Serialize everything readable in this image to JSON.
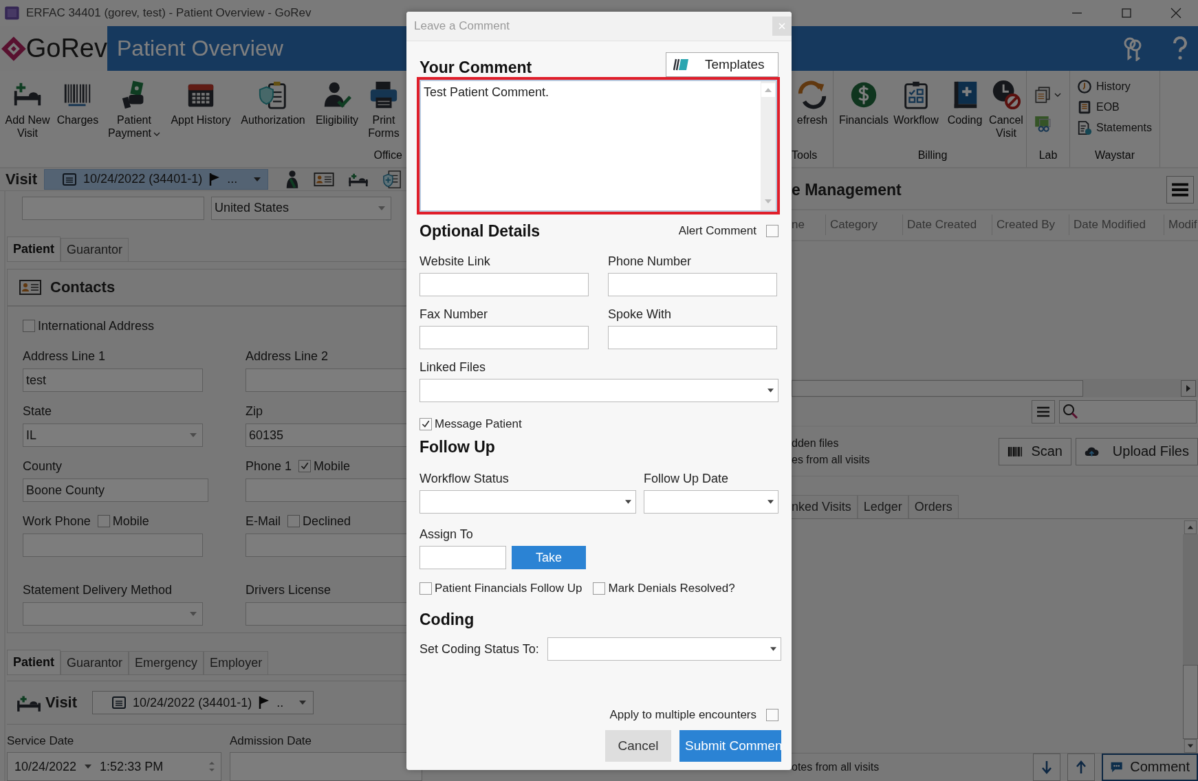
{
  "window": {
    "title": "ERFAC 34401 (gorev, test) - Patient Overview - GoRev"
  },
  "header": {
    "logo": "GoRev",
    "title": "Patient Overview"
  },
  "ribbon_left": {
    "group": "Office",
    "items": [
      {
        "label": "Add New Visit",
        "dropdown": false
      },
      {
        "label": "Charges",
        "dropdown": false
      },
      {
        "label": "Patient Payment",
        "dropdown": true
      },
      {
        "label": "Appt History",
        "dropdown": false
      },
      {
        "label": "Authorization",
        "dropdown": false
      },
      {
        "label": "Eligibility",
        "dropdown": false
      },
      {
        "label": "Print Forms",
        "dropdown": false
      }
    ]
  },
  "ribbon_right": {
    "groups": [
      {
        "label": "Tools",
        "kind": "buttons",
        "items": [
          {
            "label": "efresh"
          }
        ]
      },
      {
        "label": "Billing",
        "kind": "buttons",
        "items": [
          {
            "label": "Financials"
          },
          {
            "label": "Workflow"
          },
          {
            "label": "Coding"
          },
          {
            "label": "Cancel Visit"
          }
        ]
      },
      {
        "label": "Lab",
        "kind": "icons"
      },
      {
        "label": "Waystar",
        "kind": "list",
        "items": [
          {
            "label": "History"
          },
          {
            "label": "EOB"
          },
          {
            "label": "Statements"
          }
        ]
      }
    ]
  },
  "visit_bar": {
    "label": "Visit",
    "date": "10/24/2022 (34401-1)",
    "more": "..."
  },
  "left_panel": {
    "country": "United States",
    "tabs_top": [
      {
        "label": "Patient",
        "selected": true
      },
      {
        "label": "Guarantor",
        "selected": false
      }
    ],
    "contacts": {
      "title": "Contacts",
      "international": {
        "label": "International Address",
        "checked": false
      },
      "fields": [
        {
          "label": "Address Line 1",
          "value": "test",
          "kind": "text"
        },
        {
          "label": "Address Line 2",
          "kind": "text"
        },
        {
          "label": "State",
          "value": "IL",
          "kind": "dropdown"
        },
        {
          "label": "Zip",
          "value": "60135",
          "kind": "text"
        },
        {
          "label": "County",
          "value": "Boone County",
          "kind": "text"
        },
        {
          "label": "Phone 1",
          "kind": "text",
          "option": {
            "label": "Mobile",
            "checked": true
          }
        },
        {
          "label": "Work Phone",
          "kind": "text",
          "option": {
            "label": "Mobile",
            "checked": false
          }
        },
        {
          "label": "E-Mail",
          "kind": "text",
          "option": {
            "label": "Declined",
            "checked": false
          }
        },
        {
          "label": "Statement Delivery Method",
          "kind": "dropdown"
        },
        {
          "label": "Drivers License",
          "kind": "text"
        }
      ]
    },
    "tabs_bottom": [
      {
        "label": "Patient",
        "selected": true
      },
      {
        "label": "Guarantor",
        "selected": false
      },
      {
        "label": "Emergency",
        "selected": false
      },
      {
        "label": "Employer",
        "selected": false
      }
    ],
    "visit": {
      "label": "Visit",
      "date": "10/24/2022 (34401-1)",
      "more": ".."
    },
    "service_date": {
      "label": "Service Date",
      "date": "10/24/2022",
      "time": "1:52:33 PM"
    },
    "admission_date": {
      "label": "Admission Date"
    }
  },
  "right_panel": {
    "title": "e Management",
    "columns": [
      "ne",
      "Category",
      "Date Created",
      "Created By",
      "Date Modified",
      "Modif"
    ],
    "options": [
      "dden files",
      "es from all visits"
    ],
    "buttons": [
      "Scan",
      "Upload Files"
    ],
    "tabs": [
      {
        "label": "nked Visits",
        "selected": false
      },
      {
        "label": "Ledger",
        "selected": false
      },
      {
        "label": "Orders",
        "selected": false
      }
    ],
    "footer": {
      "text": "otes from all visits",
      "comment_button": "Comment"
    }
  },
  "dialog": {
    "title": "Leave a Comment",
    "comment": {
      "heading": "Your Comment",
      "templates_button": "Templates",
      "value": "Test Patient Comment.",
      "highlighted": true
    },
    "optional": {
      "heading": "Optional Details",
      "alert": {
        "label": "Alert Comment",
        "checked": false
      },
      "fields": [
        {
          "label": "Website Link"
        },
        {
          "label": "Phone Number"
        },
        {
          "label": "Fax Number"
        },
        {
          "label": "Spoke With"
        }
      ],
      "linked_files": {
        "label": "Linked Files"
      },
      "message_patient": {
        "label": "Message Patient",
        "checked": true
      }
    },
    "follow_up": {
      "heading": "Follow Up",
      "workflow_status": {
        "label": "Workflow Status"
      },
      "follow_up_date": {
        "label": "Follow Up Date"
      },
      "assign_to": {
        "label": "Assign To",
        "button": "Take"
      },
      "checks": [
        {
          "label": "Patient Financials Follow Up",
          "checked": false
        },
        {
          "label": "Mark Denials Resolved?",
          "checked": false
        }
      ]
    },
    "coding": {
      "heading": "Coding",
      "label": "Set Coding Status To:"
    },
    "apply_multiple": {
      "label": "Apply to multiple encounters",
      "checked": false
    },
    "buttons": [
      {
        "label": "Cancel",
        "kind": "secondary"
      },
      {
        "label": "Submit Commen",
        "kind": "primary"
      }
    ]
  }
}
